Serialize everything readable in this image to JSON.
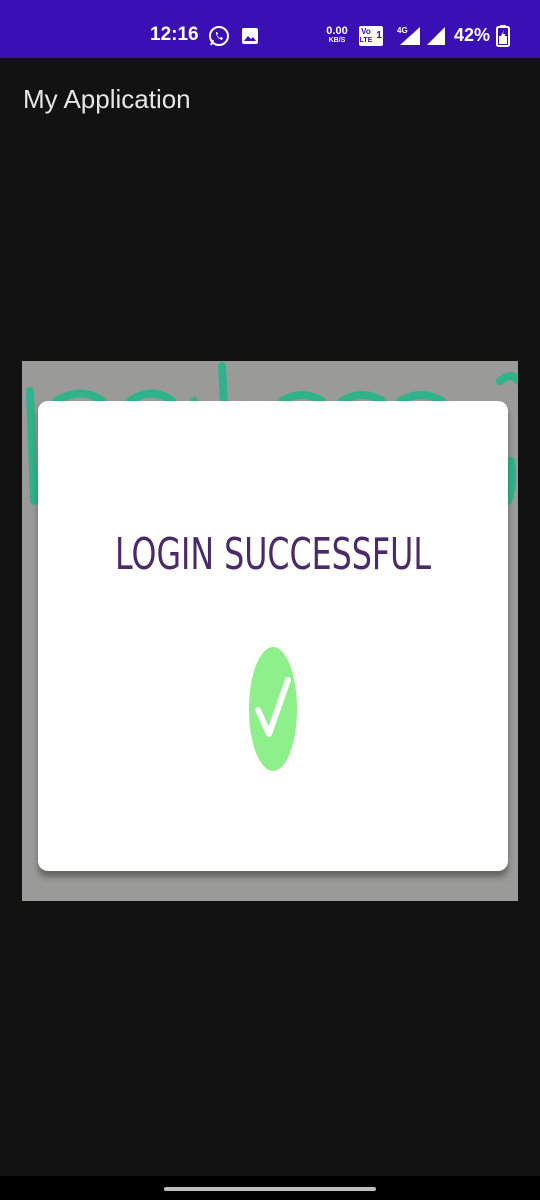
{
  "status_bar": {
    "time": "12:16",
    "net_speed_value": "0.00",
    "net_speed_unit": "KB/S",
    "volte_top": "Vo",
    "volte_bottom": "LTE",
    "sim_slot": "1",
    "network_type": "4G",
    "battery_percent": "42%",
    "icons": [
      "whatsapp-icon",
      "image-icon",
      "volte-icon",
      "signal-icon",
      "signal-icon",
      "battery-charging-icon"
    ],
    "background_color": "#3a0fb3"
  },
  "app_bar": {
    "title": "My Application"
  },
  "content": {
    "dialog_message": "LOGIN SUCCESSFUL",
    "message_color": "#4a2a6b",
    "success_icon": "check-circle-icon",
    "success_color": "#8ef08a"
  },
  "nav_bar": {
    "handle": "gesture-handle"
  }
}
